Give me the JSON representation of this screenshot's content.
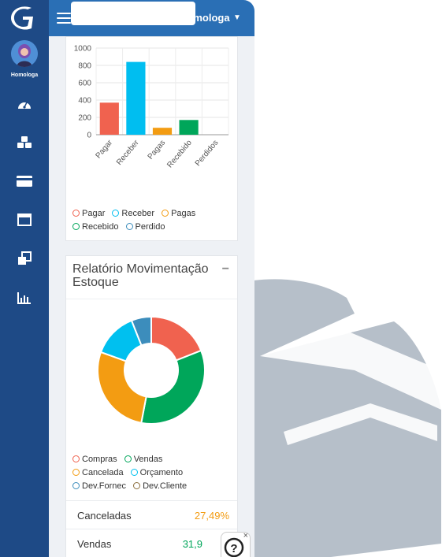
{
  "user": {
    "name": "Homologa"
  },
  "topbar": {
    "env_label": "Homologa",
    "chevron": "⌄"
  },
  "colors": {
    "sidebar": "#1e4a86",
    "topbar": "#2a6fb5",
    "pagar": "#f0624f",
    "receber": "#00bef0",
    "pagas": "#f39c12",
    "recebido": "#00a65a",
    "perdido": "#3c8dbc",
    "compras": "#f0624f",
    "vendas": "#00a65a",
    "cancelada": "#f39c12",
    "orcamento": "#00c0ef",
    "dev_fornec": "#3c8dbc",
    "dev_cliente": "#8a6d3b"
  },
  "sidebar": {
    "items": [
      {
        "icon": "dashboard-icon"
      },
      {
        "icon": "cubes-icon"
      },
      {
        "icon": "credit-card-icon"
      },
      {
        "icon": "window-icon"
      },
      {
        "icon": "clone-icon"
      },
      {
        "icon": "bar-chart-icon"
      }
    ]
  },
  "chart_data": [
    {
      "type": "bar",
      "categories": [
        "Pagar",
        "Receber",
        "Pagas",
        "Recebido",
        "Perdidos"
      ],
      "values": [
        370,
        840,
        80,
        170,
        0
      ],
      "ylim": [
        0,
        1000
      ],
      "yticks": [
        "1000",
        "800",
        "600",
        "400",
        "200",
        "0"
      ],
      "legend": [
        "Pagar",
        "Receber",
        "Pagas",
        "Recebido",
        "Perdido"
      ],
      "grid": true,
      "legend_position": "bottom"
    },
    {
      "type": "pie",
      "title": "Relatório Movimentação Estoque",
      "labels": [
        "Compras",
        "Vendas",
        "Cancelada",
        "Orçamento",
        "Dev.Fornec",
        "Dev.Cliente"
      ],
      "values": [
        19,
        34,
        27.5,
        13.5,
        6,
        0
      ],
      "legend_position": "bottom"
    }
  ],
  "card2": {
    "title": "Relatório Movimentação Estoque",
    "collapse": "−"
  },
  "stats": [
    {
      "label": "Canceladas",
      "value": "27,49%",
      "color": "#f39c12"
    },
    {
      "label": "Vendas",
      "value": "31,9",
      "color": "#00a65a"
    }
  ],
  "help": {
    "label": "?",
    "close": "×"
  }
}
